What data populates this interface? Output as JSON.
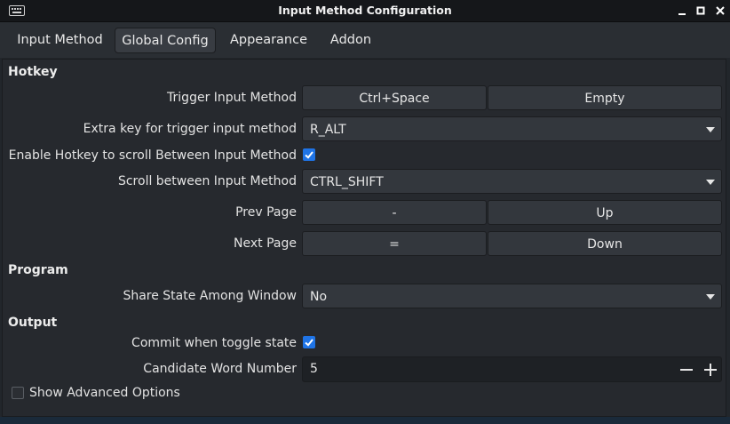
{
  "window": {
    "title": "Input Method Configuration",
    "icon": "keyboard-icon",
    "controls": [
      "minimize-icon",
      "maximize-icon",
      "close-icon"
    ]
  },
  "tabs": [
    {
      "label": "Input Method",
      "active": false
    },
    {
      "label": "Global Config",
      "active": true
    },
    {
      "label": "Appearance",
      "active": false
    },
    {
      "label": "Addon",
      "active": false
    }
  ],
  "hotkey": {
    "section": "Hotkey",
    "trigger": {
      "label": "Trigger Input Method",
      "key1": "Ctrl+Space",
      "key2": "Empty"
    },
    "extra_key": {
      "label": "Extra key for trigger input method",
      "value": "R_ALT"
    },
    "enable_scroll": {
      "label": "Enable Hotkey to scroll Between Input Method",
      "checked": true
    },
    "scroll_between": {
      "label": "Scroll between Input Method",
      "value": "CTRL_SHIFT"
    },
    "prev_page": {
      "label": "Prev Page",
      "key1": "-",
      "key2": "Up"
    },
    "next_page": {
      "label": "Next Page",
      "key1": "=",
      "key2": "Down"
    }
  },
  "program": {
    "section": "Program",
    "share_state": {
      "label": "Share State Among Window",
      "value": "No"
    }
  },
  "output": {
    "section": "Output",
    "commit_toggle": {
      "label": "Commit when toggle state",
      "checked": true
    },
    "candidate_number": {
      "label": "Candidate Word Number",
      "value": "5"
    }
  },
  "advanced": {
    "label": "Show Advanced Options",
    "checked": false
  },
  "colors": {
    "accent": "#1f74e6",
    "background": "#26292e",
    "titlebar": "#15171a"
  }
}
